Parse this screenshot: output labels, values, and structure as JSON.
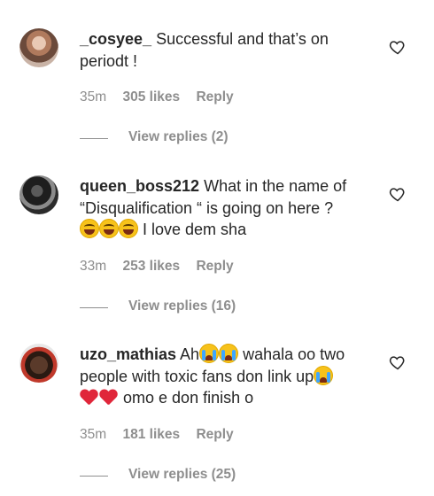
{
  "comments": [
    {
      "username": "_cosyee_",
      "text_parts": [
        "Successful and that’s on",
        "periodt !"
      ],
      "time": "35m",
      "likes": "305 likes",
      "reply_label": "Reply",
      "view_replies": "View replies (2)"
    },
    {
      "username": "queen_boss212",
      "text_parts": [
        "What in the name of",
        "“Disqualification “ is going on here ?",
        "I love dem sha"
      ],
      "emojis": [
        "face-with-tears-of-joy",
        "face-with-tears-of-joy",
        "face-with-tears-of-joy"
      ],
      "time": "33m",
      "likes": "253 likes",
      "reply_label": "Reply",
      "view_replies": "View replies (16)"
    },
    {
      "username": "uzo_mathias",
      "text_parts": [
        "Ah",
        "wahala oo two",
        "people with toxic fans don link up",
        "omo e don finish o"
      ],
      "emojis": [
        "loudly-crying-face",
        "loudly-crying-face",
        "loudly-crying-face",
        "broken-heart",
        "broken-heart"
      ],
      "time": "35m",
      "likes": "181 likes",
      "reply_label": "Reply",
      "view_replies": "View replies (25)"
    }
  ],
  "icons": {
    "like": "heart-outline-icon"
  },
  "colors": {
    "text": "#262626",
    "secondary": "#8e8e8e"
  }
}
